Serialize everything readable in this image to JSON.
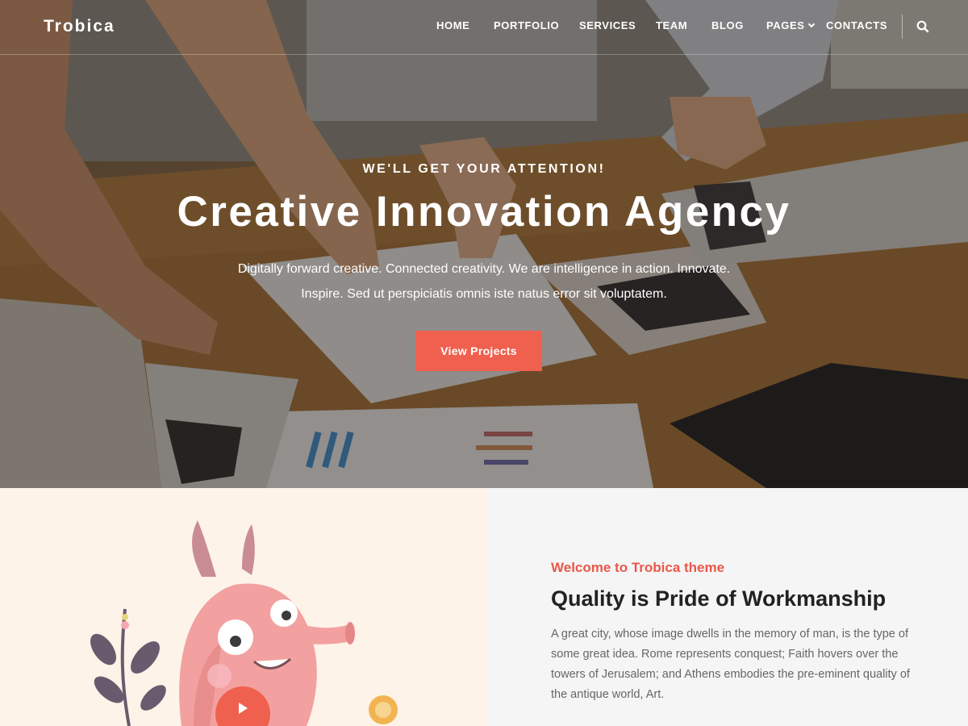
{
  "header": {
    "logo": "Trobica",
    "nav": {
      "home": "HOME",
      "portfolio": "PORTFOLIO",
      "services": "SERVICES",
      "team": "TEAM",
      "blog": "BLOG",
      "pages": "PAGES",
      "contacts": "CONTACTS"
    },
    "search_icon": "search-icon"
  },
  "hero": {
    "eyebrow": "WE'LL GET YOUR ATTENTION!",
    "title": "Creative Innovation Agency",
    "text": "Digitally forward creative. Connected creativity. We are intelligence in action. Innovate. Inspire. Sed ut perspiciatis omnis iste natus error sit voluptatem.",
    "cta_label": "View Projects"
  },
  "about": {
    "eyebrow": "Welcome to Trobica theme",
    "title": "Quality is Pride of Workmanship",
    "text": "A great city, whose image dwells in the memory of man, is the type of some great idea. Rome represents conquest; Faith hovers over the towers of Jerusalem; and Athens embodies the pre-eminent quality of the antique world, Art."
  },
  "colors": {
    "accent": "#f0604f",
    "about_left_bg": "#fdf3e8",
    "about_right_bg": "#f5f5f5",
    "heading": "#222222",
    "body_text": "#666666"
  }
}
